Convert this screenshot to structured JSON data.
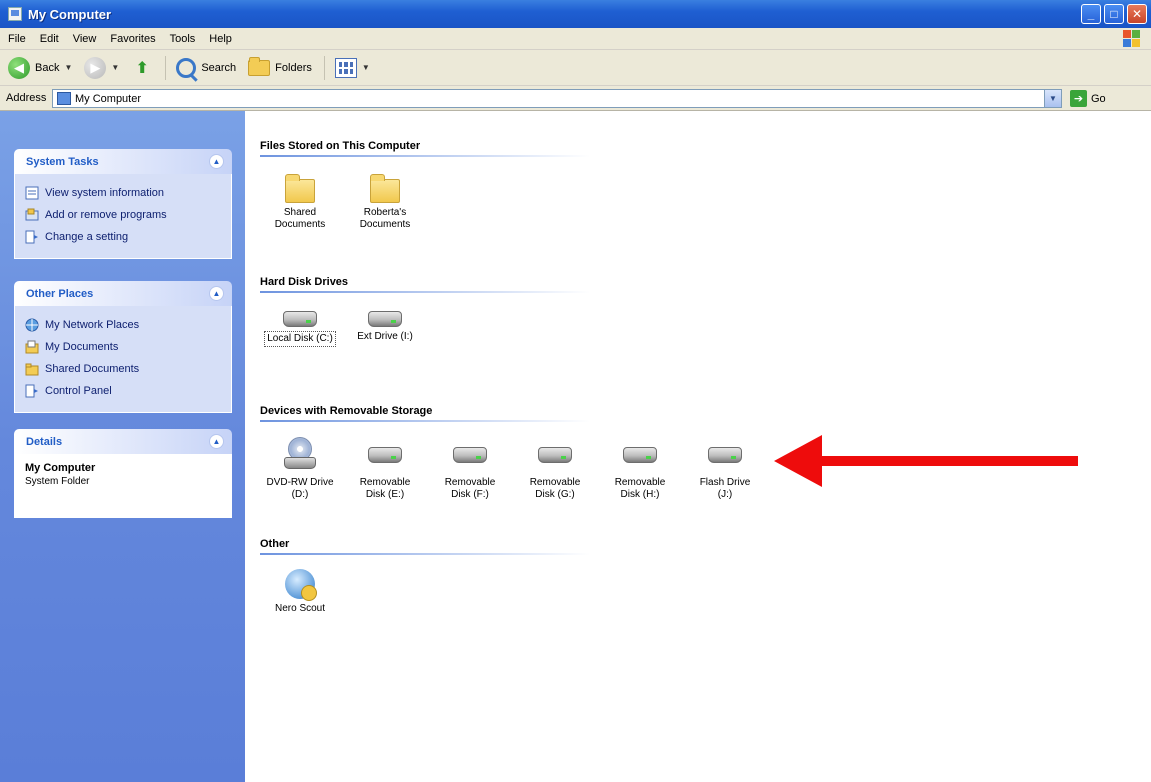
{
  "window": {
    "title": "My Computer"
  },
  "menu": [
    "File",
    "Edit",
    "View",
    "Favorites",
    "Tools",
    "Help"
  ],
  "toolbar": {
    "back": "Back",
    "search": "Search",
    "folders": "Folders"
  },
  "address": {
    "label": "Address",
    "value": "My Computer",
    "go": "Go"
  },
  "left": {
    "system_tasks": {
      "title": "System Tasks",
      "items": [
        "View system information",
        "Add or remove programs",
        "Change a setting"
      ]
    },
    "other_places": {
      "title": "Other Places",
      "items": [
        "My Network Places",
        "My Documents",
        "Shared Documents",
        "Control Panel"
      ]
    },
    "details": {
      "title": "Details",
      "name": "My Computer",
      "type": "System Folder"
    }
  },
  "groups": {
    "files": {
      "title": "Files Stored on This Computer",
      "items": [
        {
          "line1": "Shared",
          "line2": "Documents"
        },
        {
          "line1": "Roberta's",
          "line2": "Documents"
        }
      ]
    },
    "hdd": {
      "title": "Hard Disk Drives",
      "items": [
        {
          "line1": "Local Disk (C:)"
        },
        {
          "line1": "Ext Drive (I:)"
        }
      ]
    },
    "removable": {
      "title": "Devices with Removable Storage",
      "items": [
        {
          "line1": "DVD-RW Drive",
          "line2": "(D:)"
        },
        {
          "line1": "Removable",
          "line2": "Disk (E:)"
        },
        {
          "line1": "Removable",
          "line2": "Disk (F:)"
        },
        {
          "line1": "Removable",
          "line2": "Disk (G:)"
        },
        {
          "line1": "Removable",
          "line2": "Disk (H:)"
        },
        {
          "line1": "Flash Drive",
          "line2": "(J:)"
        }
      ]
    },
    "other": {
      "title": "Other",
      "items": [
        {
          "line1": "Nero Scout"
        }
      ]
    }
  },
  "colors": {
    "titlebar": "#1f5fd2",
    "taskpane": "#6488dc",
    "annotation_arrow": "#ee0c0c"
  }
}
